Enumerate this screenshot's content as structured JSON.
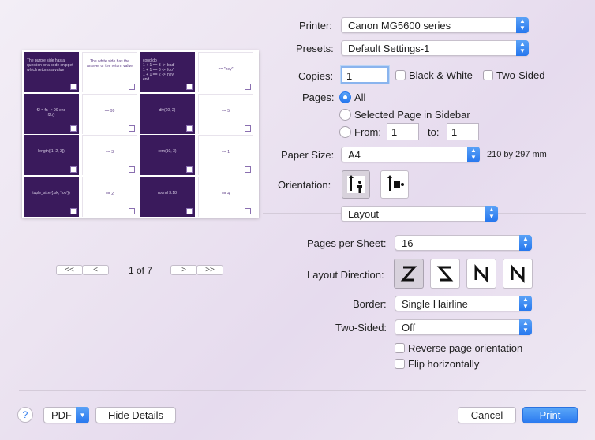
{
  "printer": {
    "label": "Printer:",
    "value": "Canon MG5600 series"
  },
  "presets": {
    "label": "Presets:",
    "value": "Default Settings-1"
  },
  "copies": {
    "label": "Copies:",
    "value": "1",
    "bw_label": "Black & White",
    "two_sided_label": "Two-Sided"
  },
  "pages": {
    "label": "Pages:",
    "all_label": "All",
    "selected_label": "Selected Page in Sidebar",
    "from_label": "From:",
    "from_value": "1",
    "to_label": "to:",
    "to_value": "1"
  },
  "paper_size": {
    "label": "Paper Size:",
    "value": "A4",
    "dimensions": "210 by 297 mm"
  },
  "orientation": {
    "label": "Orientation:"
  },
  "section": {
    "value": "Layout"
  },
  "pages_per_sheet": {
    "label": "Pages per Sheet:",
    "value": "16"
  },
  "layout_direction": {
    "label": "Layout Direction:"
  },
  "border": {
    "label": "Border:",
    "value": "Single Hairline"
  },
  "two_sided": {
    "label": "Two-Sided:",
    "value": "Off"
  },
  "options": {
    "reverse_label": "Reverse page orientation",
    "flip_label": "Flip horizontally"
  },
  "pager": {
    "first": "<<",
    "prev": "<",
    "status": "1 of 7",
    "next": ">",
    "last": ">>"
  },
  "footer": {
    "help": "?",
    "pdf": "PDF",
    "hide_details": "Hide Details",
    "cancel": "Cancel",
    "print": "Print"
  },
  "preview": {
    "cells": [
      "The purple side has a question or a code snippet which returns a value",
      "The white side has the answer or the return value",
      "cond do\n 1 + 1 == 3 -> 'bad'\n 1 + 1 == 3 -> 'foo'\n 1 + 1 == 2 -> 'hey'\nend",
      "== \"hey\"",
      "f2 = fn -> 99 end\nf2.()",
      "== 99",
      "div(10, 2)",
      "== 5",
      "length([1, 2, 3])",
      "== 3",
      "rem(10, 3)",
      "== 1",
      "tuple_size({:ok, 'foo'})",
      "== 2",
      "round 3.18",
      "== 4"
    ]
  },
  "colors": {
    "accent": "#2677ee",
    "card_dark": "#3a1a5c"
  }
}
